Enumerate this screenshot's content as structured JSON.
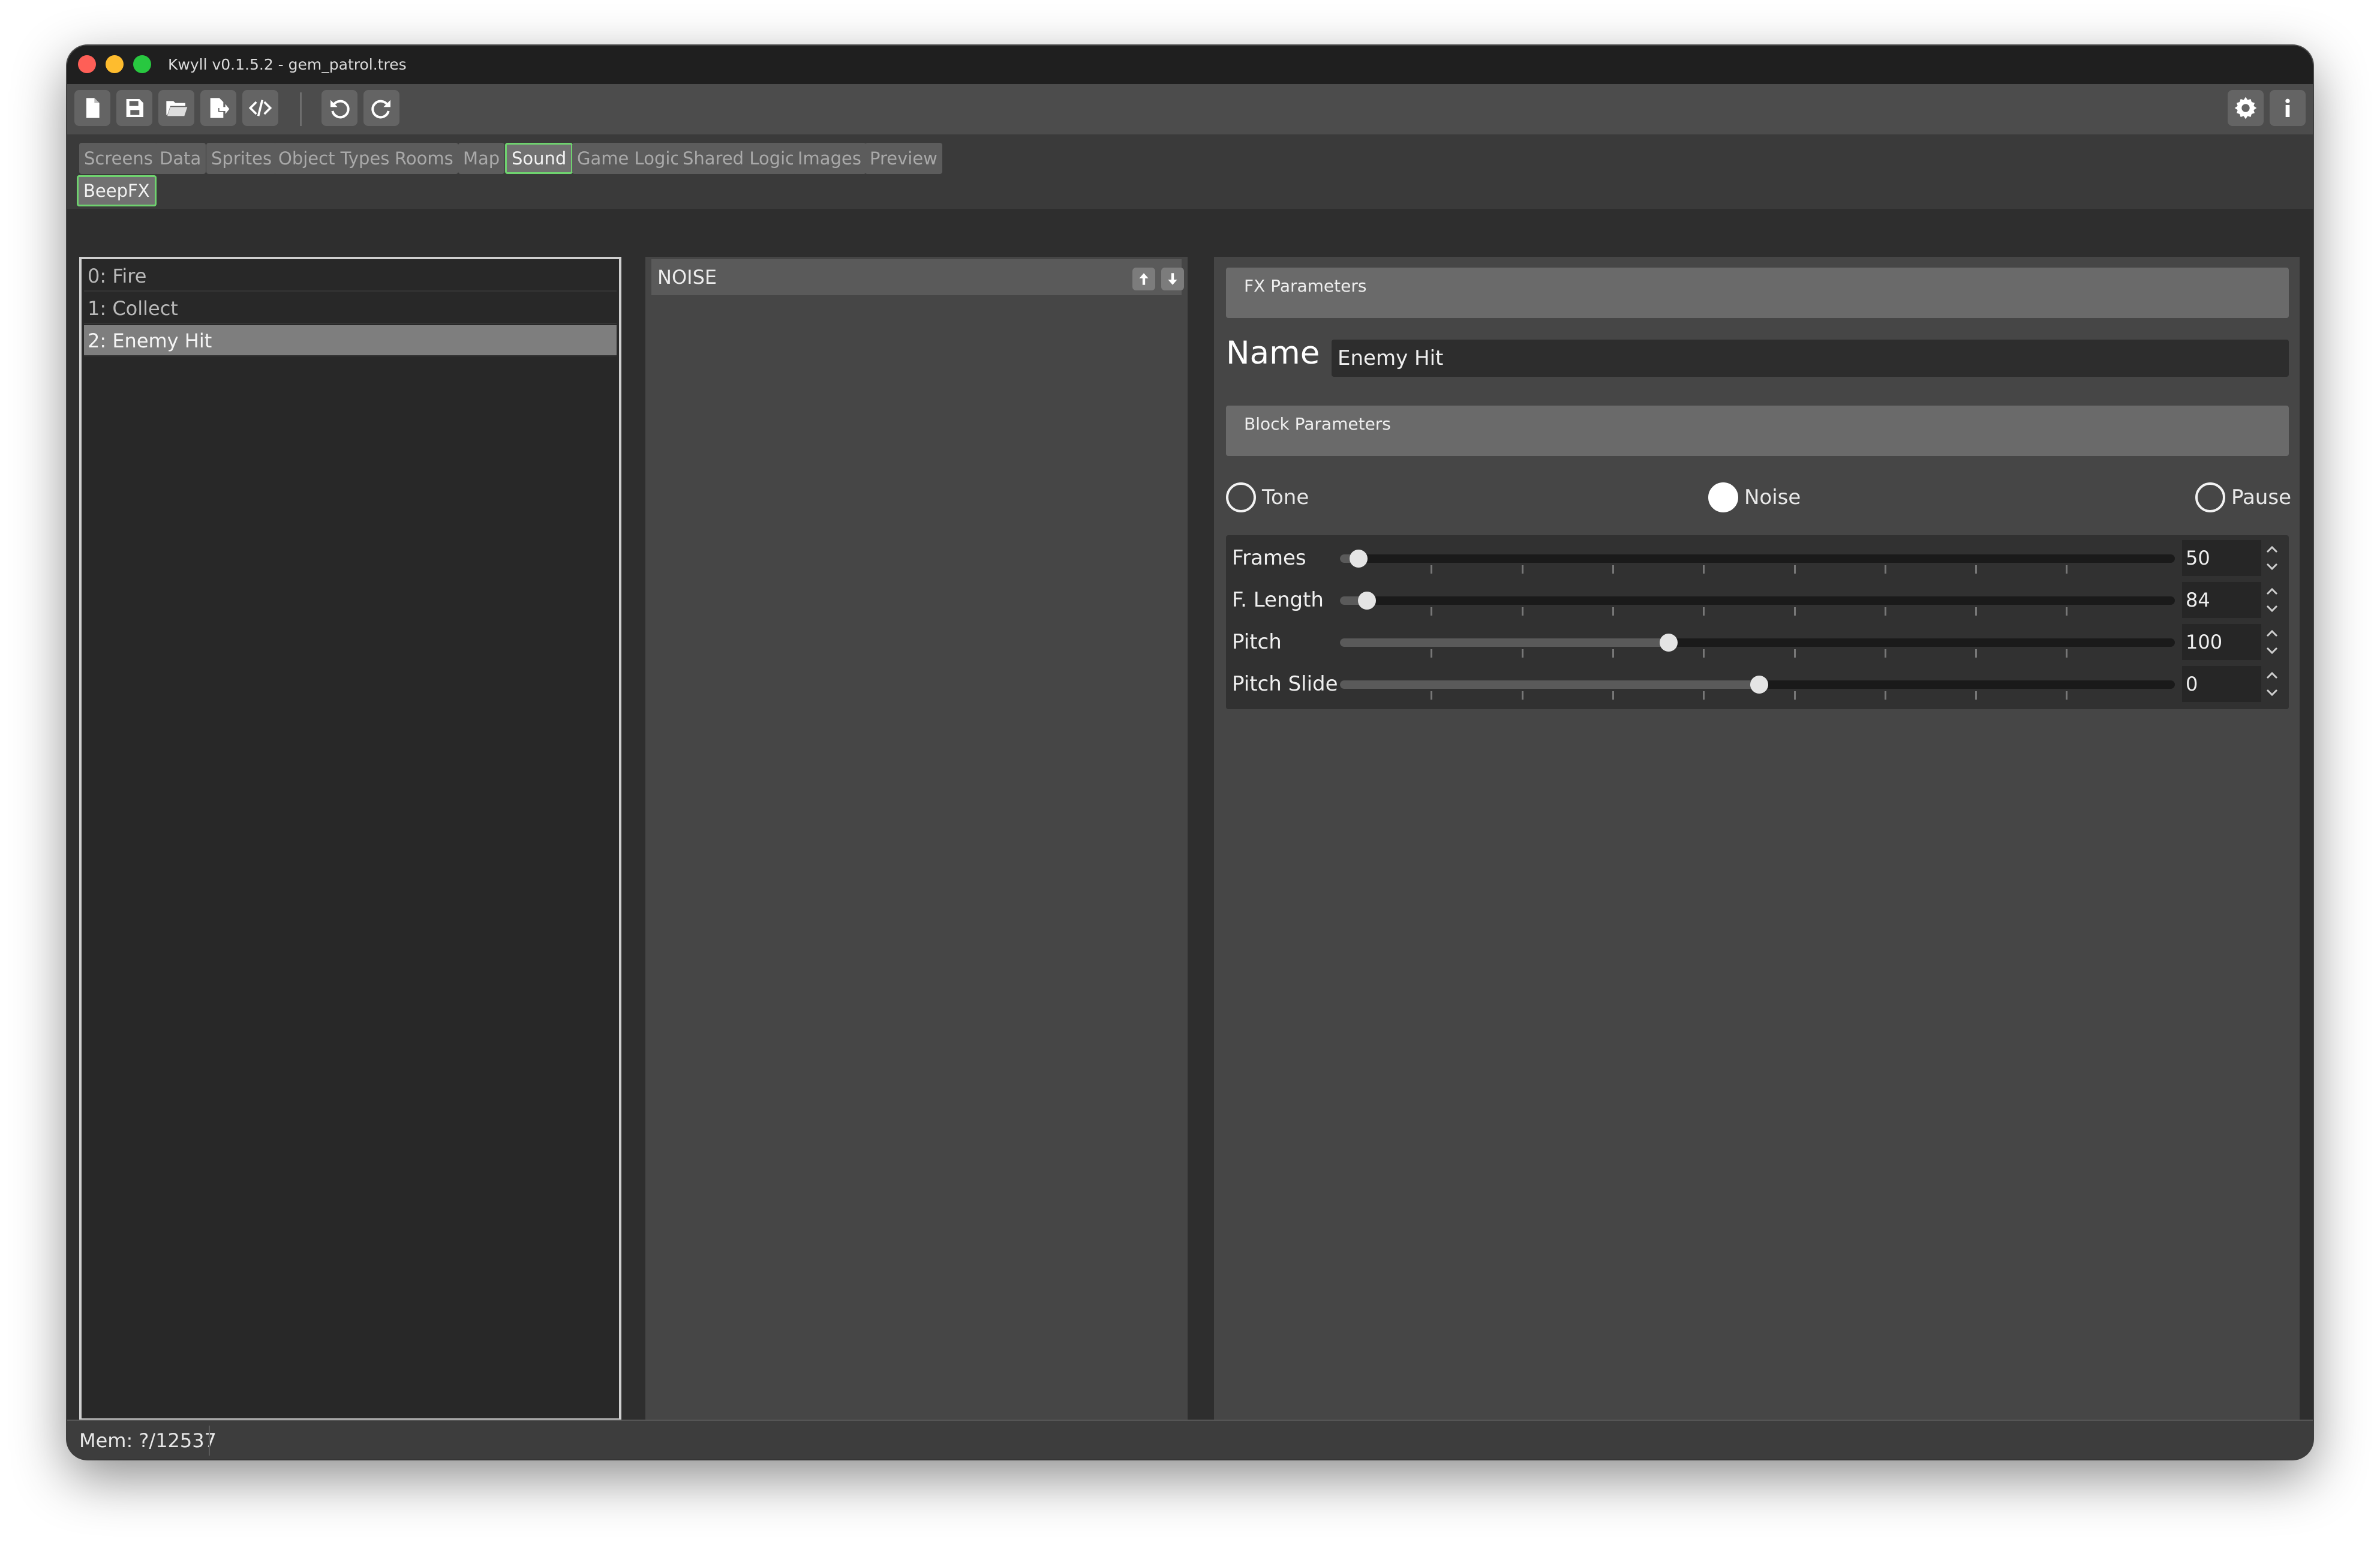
{
  "window": {
    "title": "Kwyll v0.1.5.2 - gem_patrol.tres"
  },
  "toolbar": {
    "left_icons": [
      "new-file-icon",
      "save-icon",
      "open-folder-icon",
      "export-icon",
      "code-icon",
      "undo-icon",
      "redo-icon"
    ],
    "right_icons": [
      "gear-icon",
      "info-icon"
    ]
  },
  "tabs": [
    "Screens",
    "Data",
    "Sprites",
    "Object Types",
    "Rooms",
    "Map",
    "Sound",
    "Game Logic",
    "Shared Logic",
    "Images",
    "Preview"
  ],
  "active_tab": "Sound",
  "subtabs": [
    "BeepFX"
  ],
  "fx_list": {
    "items": [
      "0: Fire",
      "1: Collect",
      "2: Enemy Hit"
    ],
    "selected_index": 2
  },
  "blocks": {
    "items": [
      "NOISE"
    ]
  },
  "fx_params": {
    "section_title": "FX Parameters",
    "name_label": "Name",
    "name_value": "Enemy Hit"
  },
  "block_params": {
    "section_title": "Block Parameters",
    "types": [
      "Tone",
      "Noise",
      "Pause"
    ],
    "selected_type": "Noise",
    "sliders": [
      {
        "label": "Frames",
        "value": "50",
        "fraction": 0.022
      },
      {
        "label": "F. Length",
        "value": "84",
        "fraction": 0.032
      },
      {
        "label": "Pitch",
        "value": "100",
        "fraction": 0.394
      },
      {
        "label": "Pitch Slide",
        "value": "0",
        "fraction": 0.502
      }
    ]
  },
  "colors": {
    "accent": "#6fd26f",
    "selected_row": "#7e7e7e"
  },
  "status": {
    "memory": "Mem: ?/12537"
  }
}
